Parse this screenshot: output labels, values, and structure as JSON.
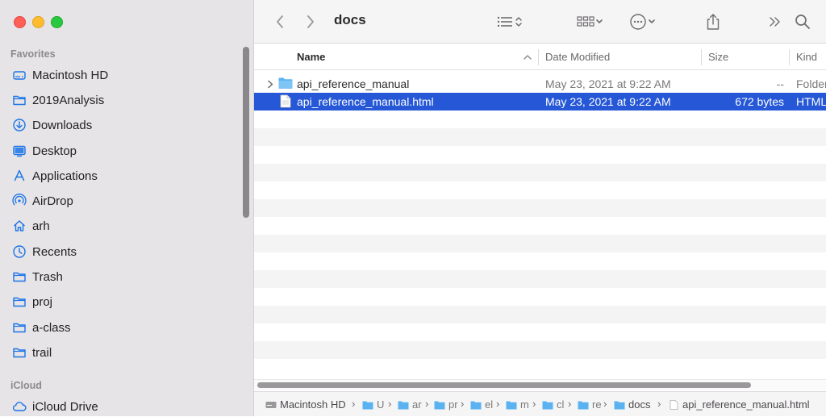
{
  "window": {
    "title": "docs"
  },
  "sidebar": {
    "sections": [
      {
        "label": "Favorites"
      },
      {
        "label": "iCloud"
      }
    ],
    "items": [
      {
        "label": "Macintosh HD",
        "icon": "drive-icon"
      },
      {
        "label": "2019Analysis",
        "icon": "folder-icon"
      },
      {
        "label": "Downloads",
        "icon": "downloads-icon"
      },
      {
        "label": "Desktop",
        "icon": "desktop-icon"
      },
      {
        "label": "Applications",
        "icon": "applications-icon"
      },
      {
        "label": "AirDrop",
        "icon": "airdrop-icon"
      },
      {
        "label": "arh",
        "icon": "home-icon"
      },
      {
        "label": "Recents",
        "icon": "clock-icon"
      },
      {
        "label": "Trash",
        "icon": "folder-icon"
      },
      {
        "label": "proj",
        "icon": "folder-icon"
      },
      {
        "label": "a-class",
        "icon": "folder-icon"
      },
      {
        "label": "trail",
        "icon": "folder-icon"
      },
      {
        "label": "iCloud Drive",
        "icon": "cloud-icon"
      }
    ]
  },
  "columns": {
    "name": "Name",
    "date": "Date Modified",
    "size": "Size",
    "kind": "Kind"
  },
  "files": [
    {
      "name": "api_reference_manual",
      "date": "May 23, 2021 at 9:22 AM",
      "size": "--",
      "kind": "Folder",
      "type": "folder",
      "selected": false
    },
    {
      "name": "api_reference_manual.html",
      "date": "May 23, 2021 at 9:22 AM",
      "size": "672 bytes",
      "kind": "HTML",
      "type": "file",
      "selected": true
    }
  ],
  "pathbar": {
    "crumbs": [
      "Macintosh HD",
      "U",
      "ar",
      "pr",
      "el",
      "m",
      "cl",
      "re",
      "docs",
      "api_reference_manual.html"
    ]
  },
  "colors": {
    "selection": "#2557d6",
    "folder": "#5ab3f0",
    "accent": "#1a73e8"
  }
}
